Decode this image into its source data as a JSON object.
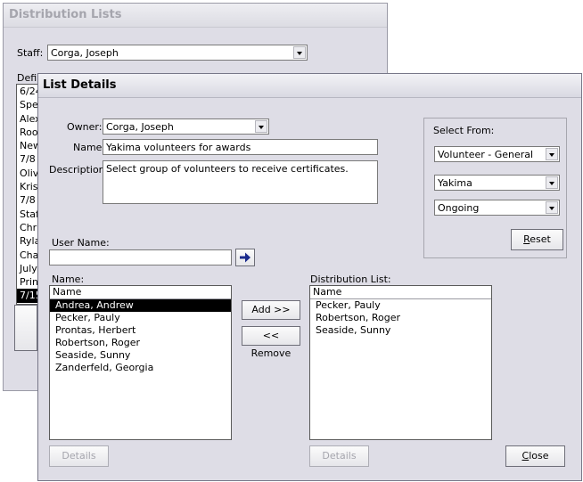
{
  "back_window": {
    "title": "Distribution Lists",
    "staff_label": "Staff:",
    "staff_value": "Corga, Joseph",
    "definitions_label": "Defin",
    "list_items": [
      "6/24",
      "Spe",
      "Alex",
      "Roo",
      "New",
      "7/8 I",
      "Olivi",
      "Kris",
      "7/8 s",
      "Staf",
      "Chri",
      "Ryla",
      "Cha",
      "July",
      "Print",
      "7/15"
    ],
    "selected_index": 15
  },
  "front_window": {
    "title": "List Details",
    "owner_label": "Owner:",
    "owner_value": "Corga, Joseph",
    "name_label": "Name:",
    "name_value": "Yakima volunteers for awards",
    "description_label": "Description:",
    "description_value": "Select group of volunteers to receive certificates.",
    "select_from": {
      "label": "Select From:",
      "combo1": "Volunteer - General",
      "combo2": "Yakima",
      "combo3": "Ongoing",
      "reset_prefix": "",
      "reset_accel": "R",
      "reset_rest": "eset"
    },
    "user_name_label": "User Name:",
    "user_name_value": "",
    "go_icon": "arrow-right-icon",
    "names_list": {
      "label": "Name:",
      "header": "Name",
      "items": [
        "Andrea, Andrew",
        "Pecker, Pauly",
        "Prontas, Herbert",
        "Robertson, Roger",
        "Seaside, Sunny",
        "Zanderfeld, Georgia"
      ],
      "selected_index": 0
    },
    "add_button": "Add >>",
    "remove_button": "<< Remove",
    "distribution_list": {
      "label": "Distribution List:",
      "header": "Name",
      "items": [
        "Pecker, Pauly",
        "Robertson, Roger",
        "Seaside, Sunny"
      ]
    },
    "details_left": "Details",
    "details_right": "Details",
    "close_accel": "C",
    "close_rest": "lose"
  },
  "colors": {
    "window_bg": "#dedde6",
    "selection_bg": "#000000",
    "arrow_icon": "#1a2a8c"
  }
}
